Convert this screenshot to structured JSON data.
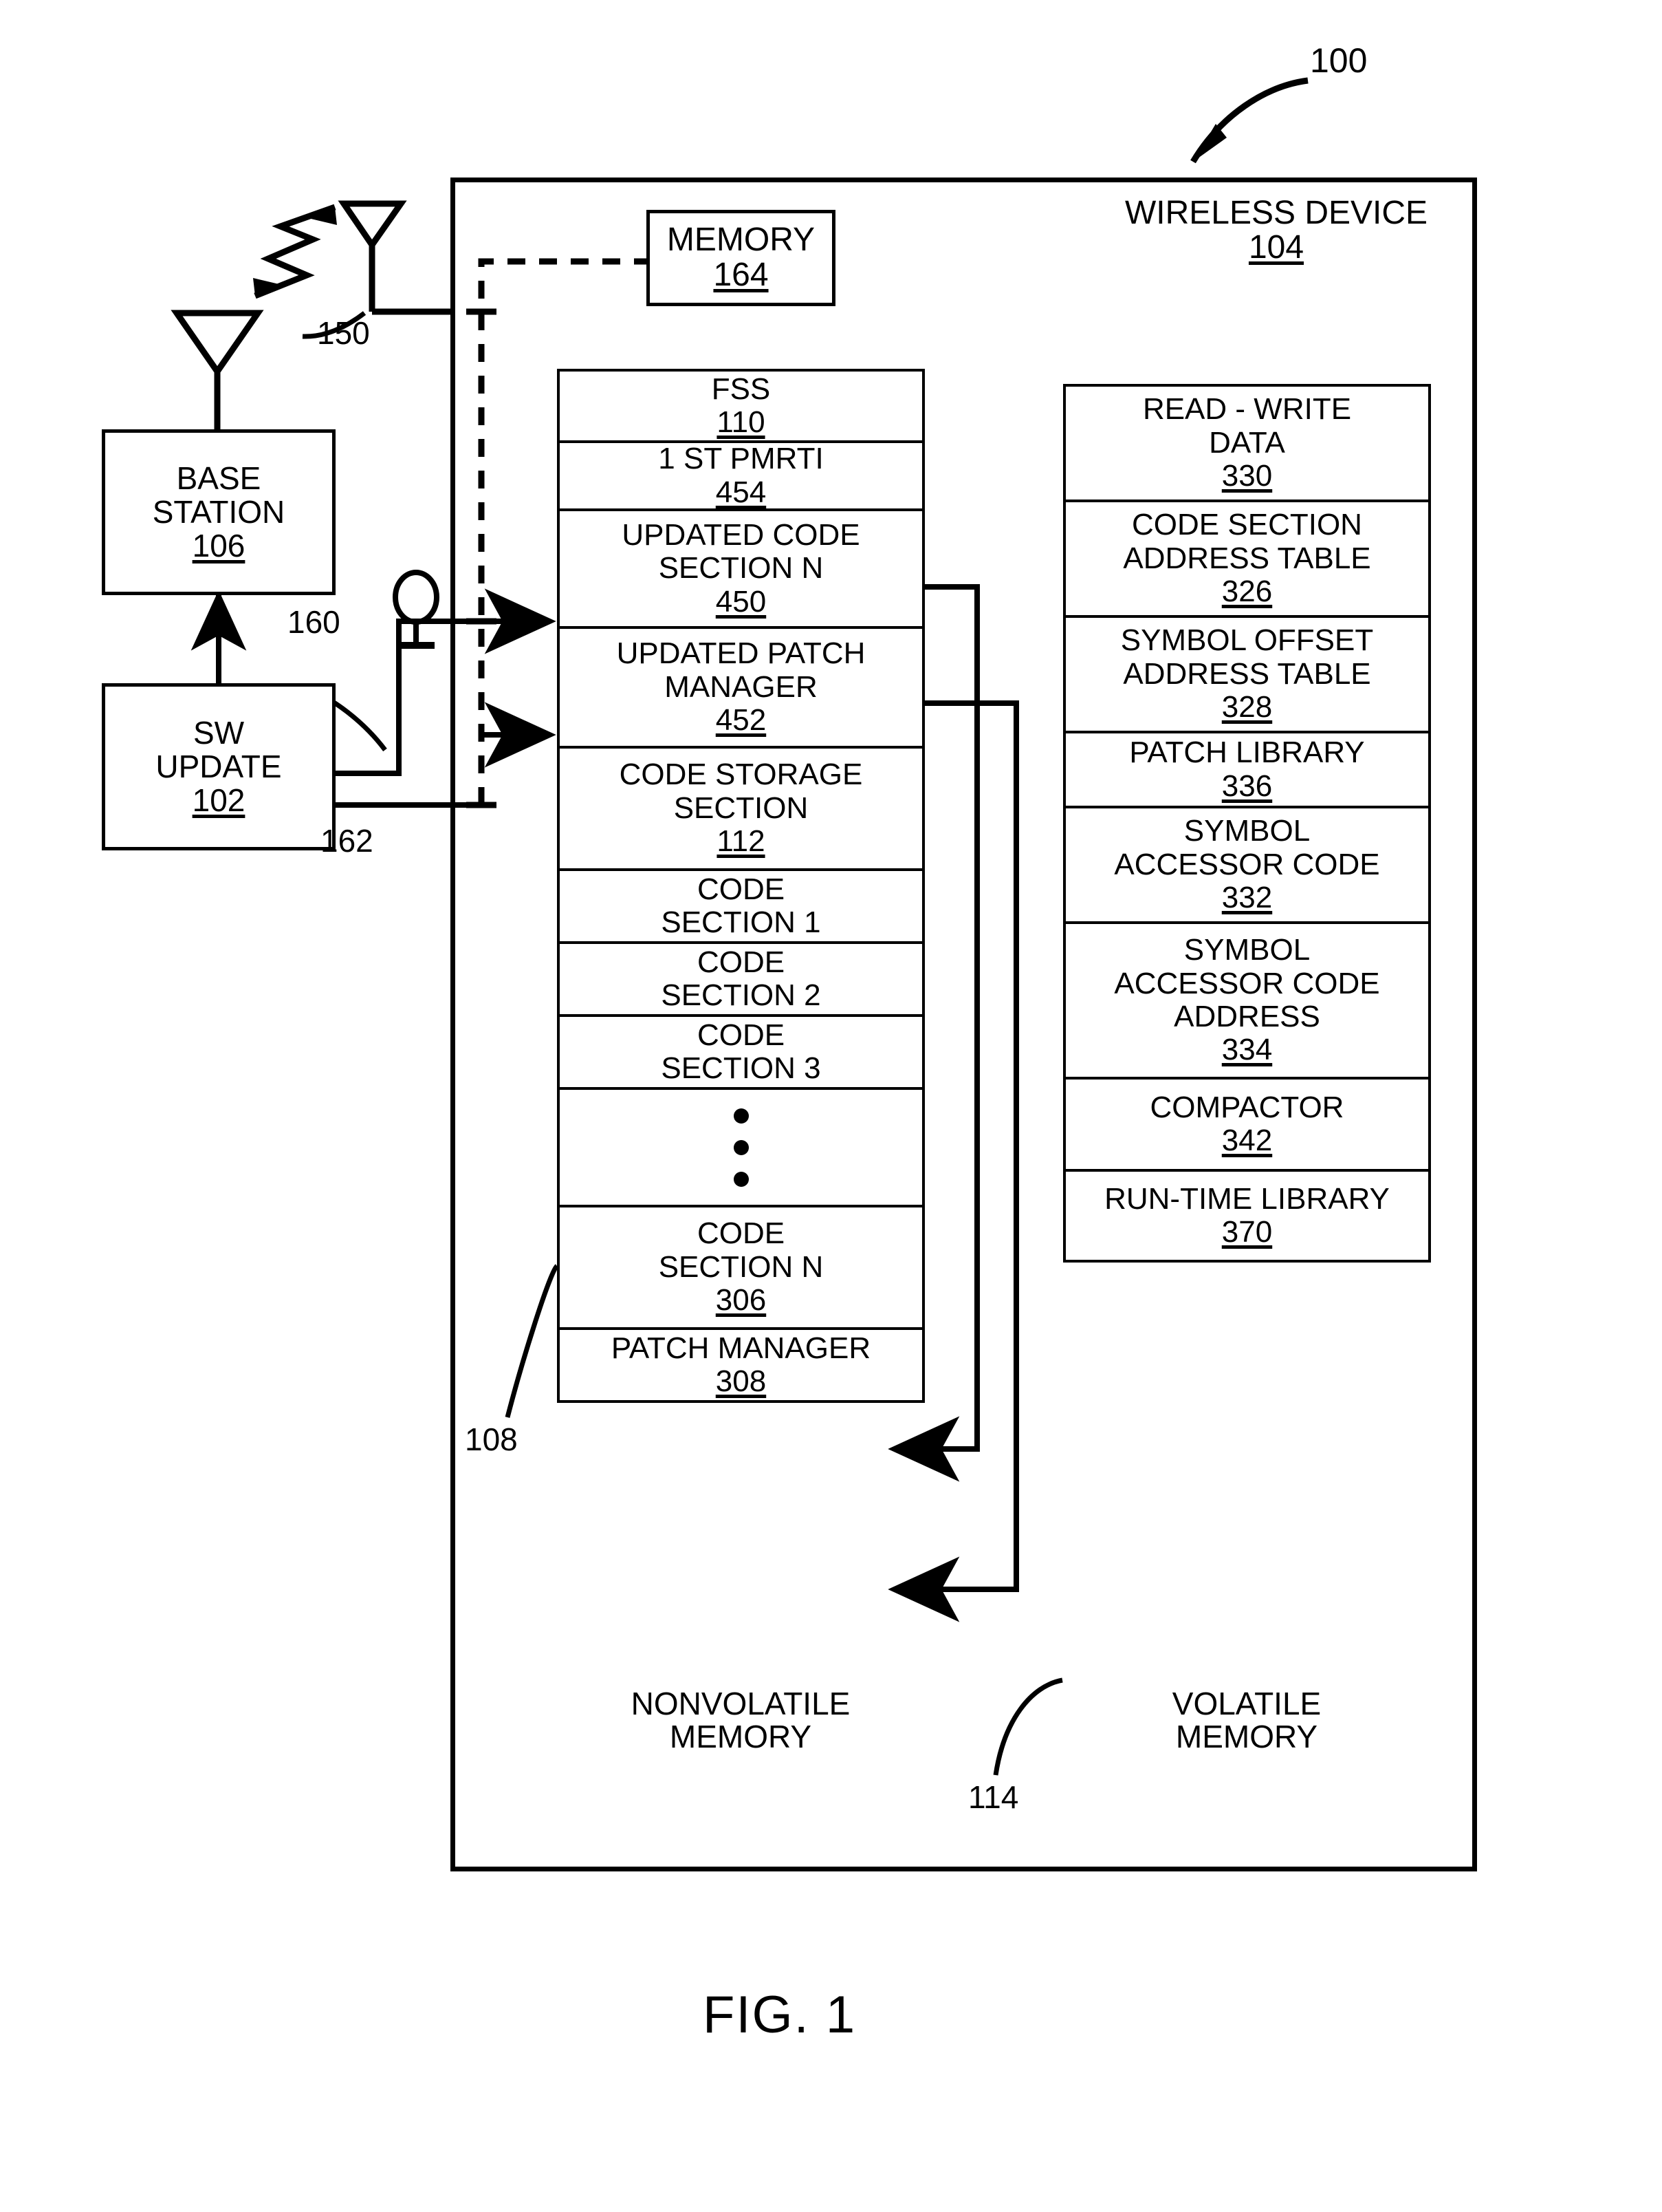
{
  "figure": {
    "caption": "FIG.   1",
    "system_ref": "100"
  },
  "wireless_device": {
    "title": "WIRELESS DEVICE",
    "ref": "104"
  },
  "external": {
    "base_station": {
      "title_line1": "BASE",
      "title_line2": "STATION",
      "ref": "106"
    },
    "sw_update": {
      "title_line1": "SW",
      "title_line2": "UPDATE",
      "ref": "102"
    },
    "antenna_ref": "150",
    "link_160_ref": "160",
    "link_162_ref": "162"
  },
  "memory_box": {
    "title": "MEMORY",
    "ref": "164"
  },
  "nonvolatile": {
    "label_line1": "NONVOLATILE",
    "label_line2": "MEMORY",
    "pointer_ref": "108",
    "rows": [
      {
        "lines": [
          "FSS"
        ],
        "ref": "110"
      },
      {
        "lines": [
          "1 ST PMRTI"
        ],
        "ref": "454"
      },
      {
        "lines": [
          "UPDATED CODE",
          "SECTION  N"
        ],
        "ref": "450"
      },
      {
        "lines": [
          "UPDATED PATCH",
          "MANAGER"
        ],
        "ref": "452"
      },
      {
        "lines": [
          "CODE STORAGE",
          "SECTION"
        ],
        "ref": "112"
      },
      {
        "lines": [
          "CODE",
          "SECTION  1"
        ],
        "ref": ""
      },
      {
        "lines": [
          "CODE",
          "SECTION  2"
        ],
        "ref": ""
      },
      {
        "lines": [
          "CODE",
          "SECTION  3"
        ],
        "ref": ""
      },
      {
        "lines": [],
        "ref": "",
        "dots": true
      },
      {
        "lines": [
          "CODE",
          "SECTION  N"
        ],
        "ref": "306"
      },
      {
        "lines": [
          "PATCH MANAGER"
        ],
        "ref": "308"
      }
    ]
  },
  "volatile": {
    "label_line1": "VOLATILE",
    "label_line2": "MEMORY",
    "pointer_ref": "114",
    "rows": [
      {
        "lines": [
          "READ - WRITE",
          "DATA"
        ],
        "ref": "330"
      },
      {
        "lines": [
          "CODE SECTION",
          "ADDRESS TABLE"
        ],
        "ref": "326"
      },
      {
        "lines": [
          "SYMBOL OFFSET",
          "ADDRESS TABLE"
        ],
        "ref": "328"
      },
      {
        "lines": [
          "PATCH  LIBRARY"
        ],
        "ref": "336"
      },
      {
        "lines": [
          "SYMBOL",
          "ACCESSOR CODE"
        ],
        "ref": "332"
      },
      {
        "lines": [
          "SYMBOL",
          "ACCESSOR CODE",
          "ADDRESS"
        ],
        "ref": "334"
      },
      {
        "lines": [
          "COMPACTOR"
        ],
        "ref": "342"
      },
      {
        "lines": [
          "RUN-TIME LIBRARY"
        ],
        "ref": "370"
      }
    ]
  },
  "colors": {
    "ink": "#000000",
    "paper": "#ffffff"
  }
}
